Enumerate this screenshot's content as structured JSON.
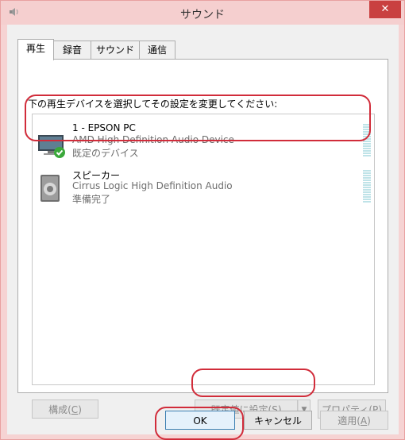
{
  "window": {
    "title": "サウンド",
    "close_label": "✕"
  },
  "tabs": [
    {
      "label": "再生",
      "active": true
    },
    {
      "label": "録音",
      "active": false
    },
    {
      "label": "サウンド",
      "active": false
    },
    {
      "label": "通信",
      "active": false
    }
  ],
  "instruction": "下の再生デバイスを選択してその設定を変更してください:",
  "devices": [
    {
      "name": "1 - EPSON PC",
      "description": "AMD High Definition Audio Device",
      "status": "既定のデバイス",
      "icon": "monitor-icon",
      "default": true
    },
    {
      "name": "スピーカー",
      "description": "Cirrus Logic High Definition Audio",
      "status": "準備完了",
      "icon": "speaker-icon",
      "default": false
    }
  ],
  "buttons": {
    "configure_prefix": "構成(",
    "configure_key": "C",
    "configure_suffix": ")",
    "set_default_prefix": "既定値に設定(",
    "set_default_key": "S",
    "set_default_suffix": ")",
    "set_default_arrow": "▼",
    "properties_prefix": "プロパティ(",
    "properties_key": "P",
    "properties_suffix": ")",
    "ok": "OK",
    "cancel": "キャンセル",
    "apply_prefix": "適用(",
    "apply_key": "A",
    "apply_suffix": ")"
  },
  "colors": {
    "highlight": "#d12c3a",
    "title_bar": "#f5cfcf",
    "close_button": "#c94040"
  }
}
